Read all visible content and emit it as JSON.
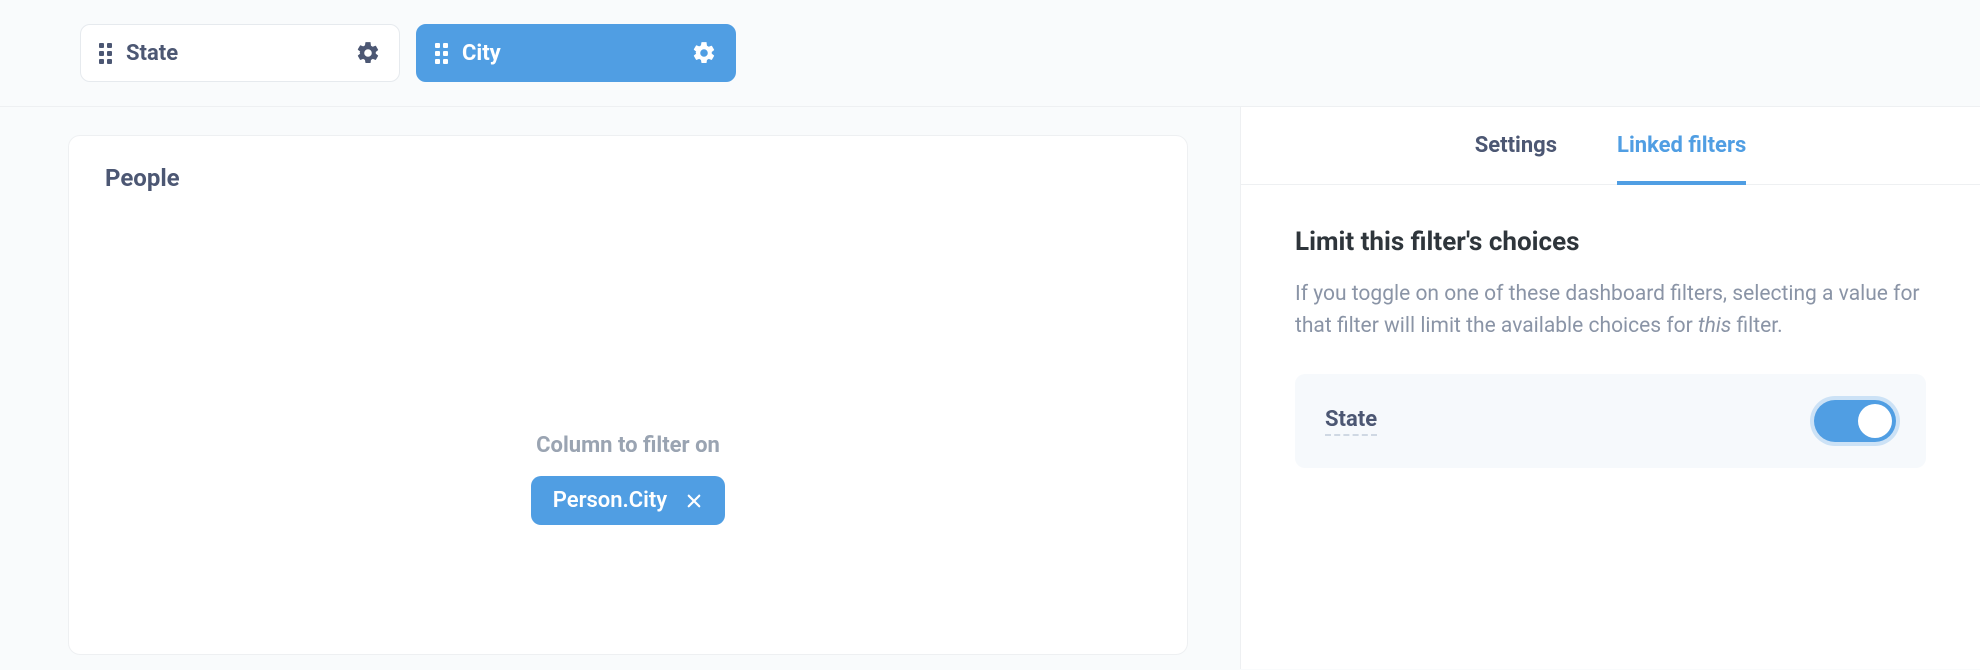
{
  "filters": {
    "chips": [
      {
        "label": "State",
        "active": false
      },
      {
        "label": "City",
        "active": true
      }
    ]
  },
  "card": {
    "title": "People",
    "column_label": "Column to filter on",
    "column_value": "Person.City"
  },
  "sidebar": {
    "tabs": {
      "settings": "Settings",
      "linked": "Linked filters"
    },
    "panel_title": "Limit this filter's choices",
    "panel_desc_1": "If you toggle on one of these dashboard filters, selecting a value for that filter will limit the available choices for ",
    "panel_desc_em": "this",
    "panel_desc_2": " filter.",
    "linked_option": {
      "label": "State"
    }
  }
}
